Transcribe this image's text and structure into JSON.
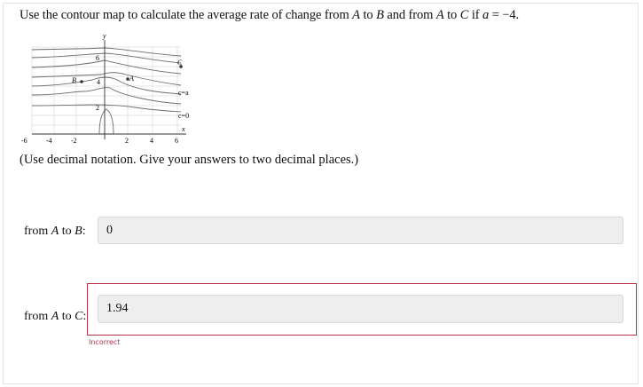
{
  "question": {
    "prefix": "Use the contour map to calculate the average rate of change from ",
    "a1": "A",
    "to1": " to ",
    "b": "B",
    "and": " and from ",
    "a2": "A",
    "to2": " to ",
    "c": "C",
    "if": " if ",
    "var": "a",
    "value": " = −4."
  },
  "instructions": "(Use decimal notation. Give your answers to two decimal places.)",
  "plot": {
    "y_axis_label": "y",
    "x_axis_label": "x",
    "x_ticks": [
      "-6",
      "-4",
      "-2",
      "2",
      "4",
      "6"
    ],
    "contour_labels": [
      "6",
      "4",
      "2"
    ],
    "level_labels": [
      "c=a",
      "c=0"
    ],
    "points": [
      "A",
      "B",
      "C"
    ]
  },
  "answers": {
    "ab_label_prefix": "from ",
    "ab_label_a": "A",
    "ab_label_to": " to ",
    "ab_label_b": "B",
    "ab_label_colon": ":",
    "ab_value": "0",
    "ac_label_prefix": "from ",
    "ac_label_a": "A",
    "ac_label_to": " to ",
    "ac_label_c": "C",
    "ac_label_colon": ":",
    "ac_value": "1.94",
    "ac_feedback": "Incorrect"
  },
  "colors": {
    "incorrect": "#b3324a",
    "input_bg": "#eeeeee"
  }
}
